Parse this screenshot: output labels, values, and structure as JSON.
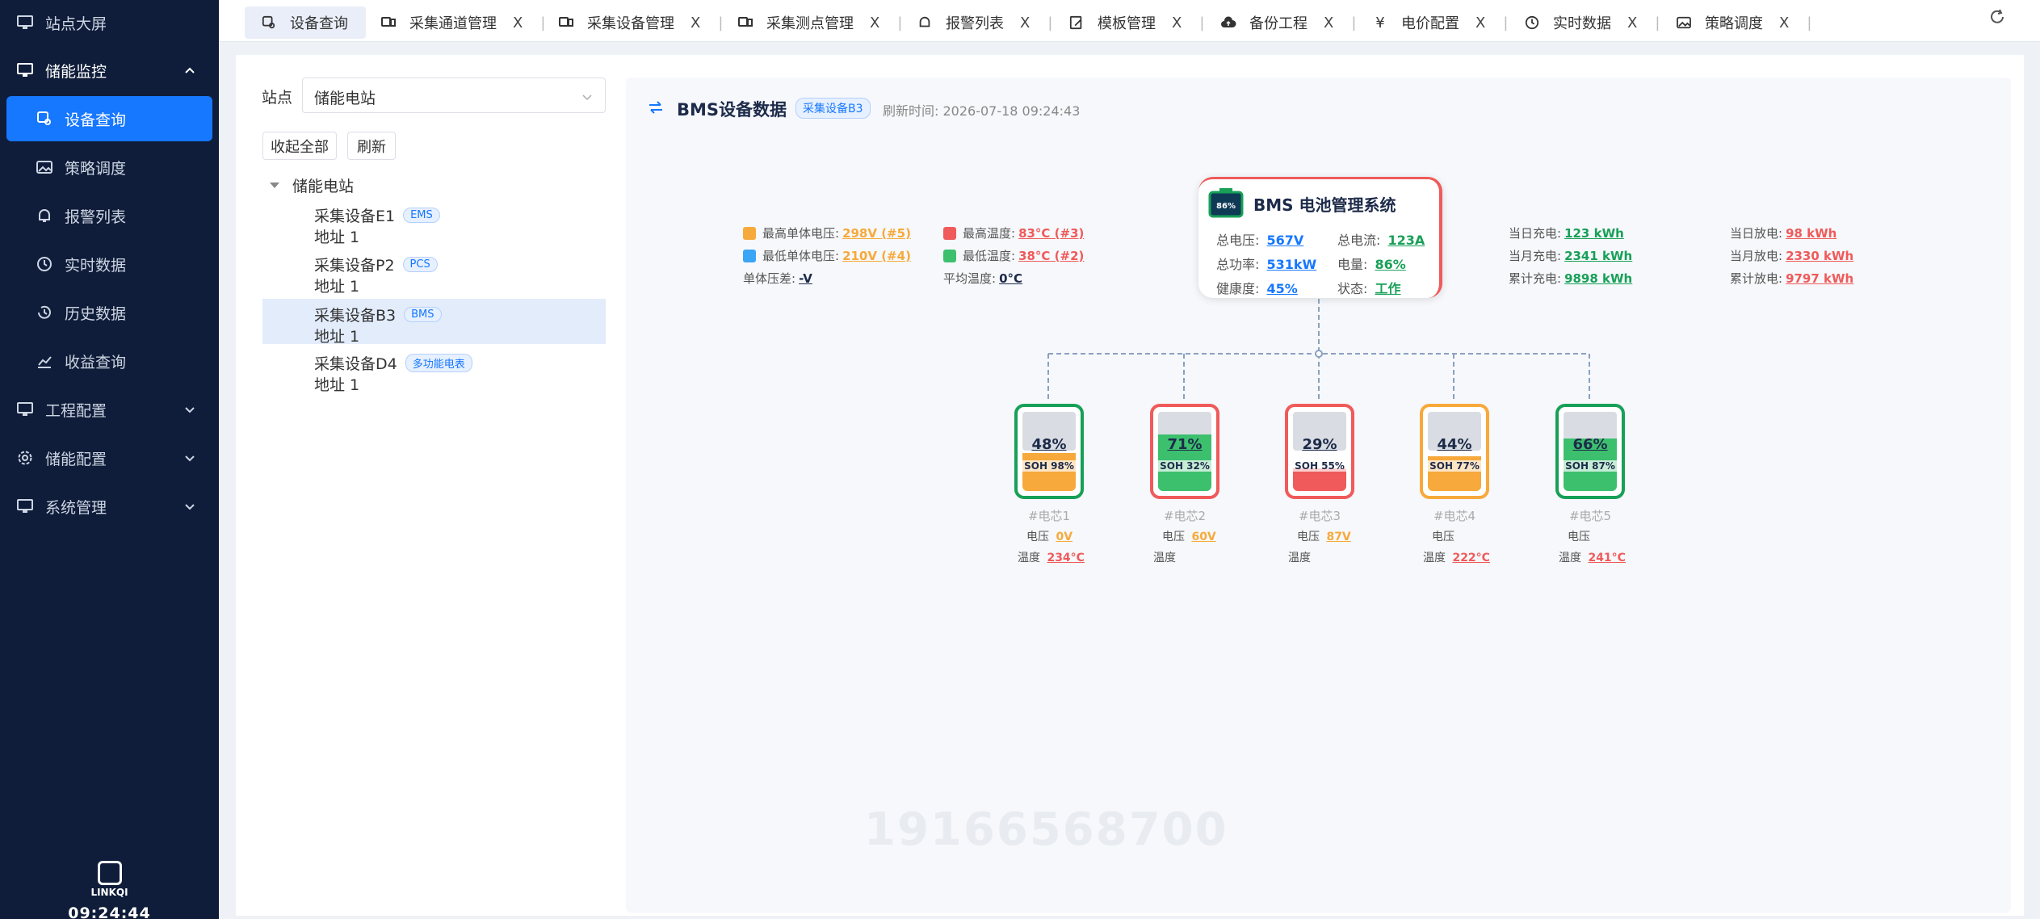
{
  "sidebar": {
    "items": [
      {
        "label": "站点大屏",
        "icon": "monitor-icon"
      },
      {
        "label": "储能监控",
        "icon": "monitor-icon"
      },
      {
        "label": "设备查询",
        "icon": "device-search-icon"
      },
      {
        "label": "策略调度",
        "icon": "image-icon"
      },
      {
        "label": "报警列表",
        "icon": "bell-icon"
      },
      {
        "label": "实时数据",
        "icon": "clock-icon"
      },
      {
        "label": "历史数据",
        "icon": "history-icon"
      },
      {
        "label": "收益查询",
        "icon": "chart-icon"
      },
      {
        "label": "工程配置",
        "icon": "project-icon"
      },
      {
        "label": "储能配置",
        "icon": "gear-icon"
      },
      {
        "label": "系统管理",
        "icon": "system-icon"
      }
    ],
    "logo_text": "LINKQI",
    "clock": "09:24:44"
  },
  "tabs": [
    {
      "label": "设备查询"
    },
    {
      "label": "采集通道管理"
    },
    {
      "label": "采集设备管理"
    },
    {
      "label": "采集测点管理"
    },
    {
      "label": "报警列表"
    },
    {
      "label": "模板管理"
    },
    {
      "label": "备份工程"
    },
    {
      "label": "电价配置"
    },
    {
      "label": "实时数据"
    },
    {
      "label": "策略调度"
    }
  ],
  "tab_close": "X",
  "left": {
    "station_label": "站点",
    "station_value": "储能电站",
    "collapse_btn": "收起全部",
    "refresh_btn": "刷新",
    "tree_root": "储能电站",
    "nodes": [
      {
        "title": "采集设备E1",
        "tag": "EMS",
        "addr": "地址 1"
      },
      {
        "title": "采集设备P2",
        "tag": "PCS",
        "addr": "地址 1"
      },
      {
        "title": "采集设备B3",
        "tag": "BMS",
        "addr": "地址 1"
      },
      {
        "title": "采集设备D4",
        "tag": "多功能电表",
        "addr": "地址 1"
      }
    ]
  },
  "panel": {
    "title": "BMS设备数据",
    "tag": "采集设备B3",
    "refresh_time": "刷新时间:  2026-07-18 09:24:43",
    "left_stats": {
      "max_cell_v_label": "最高单体电压:",
      "max_cell_v": "298V (#5)",
      "min_cell_v_label": "最低单体电压:",
      "min_cell_v": "210V (#4)",
      "cell_diff_label": "单体压差:",
      "cell_diff": "-V",
      "max_temp_label": "最高温度:",
      "max_temp": "83°C (#3)",
      "min_temp_label": "最低温度:",
      "min_temp": "38°C (#2)",
      "avg_temp_label": "平均温度:",
      "avg_temp": "0°C"
    },
    "bms": {
      "title": "BMS 电池管理系统",
      "chip_pct": "86%",
      "total_v_label": "总电压:",
      "total_v": "567V",
      "total_i_label": "总电流:",
      "total_i": "123A",
      "total_p_label": "总功率:",
      "total_p": "531kW",
      "soc_label": "电量:",
      "soc": "86%",
      "health_label": "健康度:",
      "health": "45%",
      "state_label": "状态:",
      "state": "工作"
    },
    "right_stats": {
      "day_charge_label": "当日充电:",
      "day_charge": "123 kWh",
      "month_charge_label": "当月充电:",
      "month_charge": "2341 kWh",
      "total_charge_label": "累计充电:",
      "total_charge": "9898 kWh",
      "day_discharge_label": "当日放电:",
      "day_discharge": "98 kWh",
      "month_discharge_label": "当月放电:",
      "month_discharge": "2330 kWh",
      "total_discharge_label": "累计放电:",
      "total_discharge": "9797 kWh"
    },
    "cells": [
      {
        "pct": "48%",
        "soh": "SOH 98%",
        "name": "#电芯1",
        "v_label": "电压",
        "v": "0V",
        "t_label": "温度",
        "t": "234°C",
        "fill": 0.48,
        "fill_color": "#f7a93b",
        "border": "#18a058"
      },
      {
        "pct": "71%",
        "soh": "SOH 32%",
        "name": "#电芯2",
        "v_label": "电压",
        "v": "60V",
        "t_label": "温度",
        "t": "",
        "fill": 0.71,
        "fill_color": "#3cc06e",
        "border": "#f05a5a"
      },
      {
        "pct": "29%",
        "soh": "SOH 55%",
        "name": "#电芯3",
        "v_label": "电压",
        "v": "87V",
        "t_label": "温度",
        "t": "",
        "fill": 0.29,
        "fill_color": "#f05a5a",
        "border": "#f05a5a"
      },
      {
        "pct": "44%",
        "soh": "SOH 77%",
        "name": "#电芯4",
        "v_label": "电压",
        "v": "",
        "t_label": "温度",
        "t": "222°C",
        "fill": 0.44,
        "fill_color": "#f7a93b",
        "border": "#f7a93b"
      },
      {
        "pct": "66%",
        "soh": "SOH 87%",
        "name": "#电芯5",
        "v_label": "电压",
        "v": "",
        "t_label": "温度",
        "t": "241°C",
        "fill": 0.66,
        "fill_color": "#3cc06e",
        "border": "#18a058"
      }
    ],
    "watermark": "19166568700"
  },
  "colors": {
    "sidebar_bg": "#0f1d3a",
    "accent": "#1677ff",
    "green": "#18a058",
    "orange": "#f7a93b",
    "red": "#f05a5a"
  }
}
